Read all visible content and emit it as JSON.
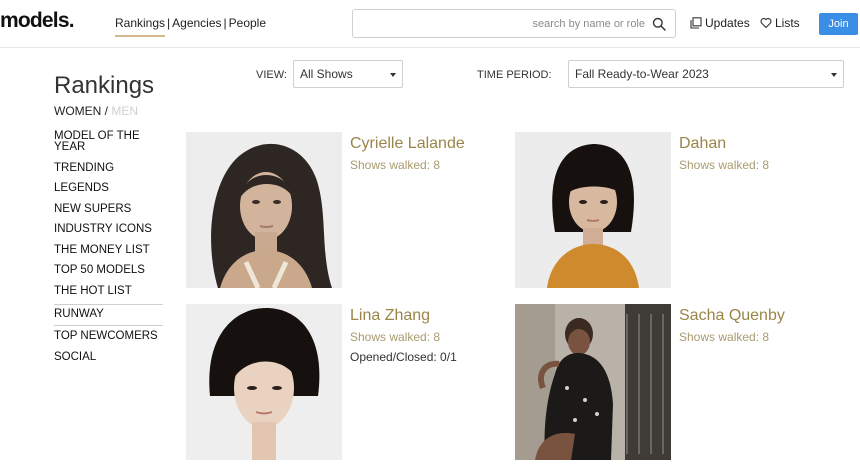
{
  "header": {
    "logo": "models.",
    "nav": [
      "Rankings",
      "Agencies",
      "People"
    ],
    "nav_separator": "|",
    "search": {
      "value": "",
      "placeholder": "search by name or role"
    },
    "updates_label": "Updates",
    "lists_label": "Lists",
    "join_label": "Join"
  },
  "sidebar": {
    "title": "Rankings",
    "women_label": "WOMEN",
    "slash": "/",
    "men_label": "MEN",
    "items": [
      "MODEL OF THE YEAR",
      "TRENDING",
      "LEGENDS",
      "NEW SUPERS",
      "INDUSTRY ICONS",
      "THE MONEY LIST",
      "TOP 50 MODELS",
      "THE HOT LIST",
      "RUNWAY",
      "TOP NEWCOMERS",
      "SOCIAL"
    ]
  },
  "filters": {
    "view_label": "VIEW:",
    "view_value": "All Shows",
    "period_label": "TIME PERIOD:",
    "period_value": "Fall Ready-to-Wear 2023"
  },
  "models": [
    {
      "name": "Cyrielle Lalande",
      "shows": "Shows walked: 8",
      "extra": ""
    },
    {
      "name": "Dahan",
      "shows": "Shows walked: 8",
      "extra": ""
    },
    {
      "name": "Lina Zhang",
      "shows": "Shows walked: 8",
      "extra": "Opened/Closed: 0/1"
    },
    {
      "name": "Sacha Quenby",
      "shows": "Shows walked: 8",
      "extra": ""
    }
  ],
  "colors": {
    "accent_gold": "#9a8549",
    "join_blue": "#3a8ee6"
  }
}
